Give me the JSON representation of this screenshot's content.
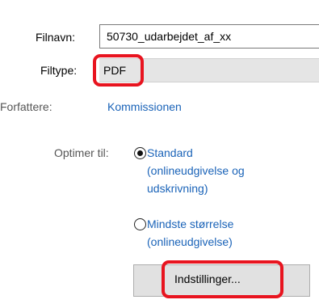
{
  "fields": {
    "filnavn_label": "Filnavn:",
    "filnavn_value": "50730_udarbejdet_af_xx",
    "filtype_label": "Filtype:",
    "filtype_value": "PDF"
  },
  "meta": {
    "forfattere_label": "Forfattere:",
    "forfattere_value": "Kommissionen"
  },
  "optimize": {
    "label": "Optimer til:",
    "selected": "standard",
    "options": [
      {
        "id": "standard",
        "lines": [
          "Standard",
          "(onlineudgivelse og",
          "udskrivning)"
        ]
      },
      {
        "id": "minimum",
        "lines": [
          "Mindste størrelse",
          "(onlineudgivelse)"
        ]
      }
    ]
  },
  "buttons": {
    "settings_label": "Indstillinger..."
  },
  "colors": {
    "highlight": "#e8141f",
    "link": "#1a63b8"
  }
}
